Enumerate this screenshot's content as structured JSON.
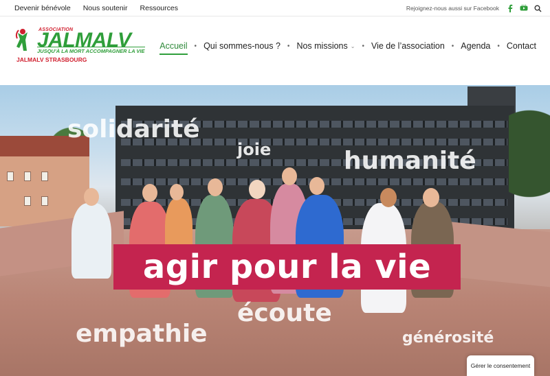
{
  "topbar": {
    "links": [
      "Devenir bénévole",
      "Nous soutenir",
      "Ressources"
    ],
    "facebook_text": "Rejoignez-nous aussi sur Facebook",
    "icons": [
      "facebook-icon",
      "youtube-icon",
      "search-icon"
    ]
  },
  "logo": {
    "assoc": "ASSOCIATION",
    "brand": "JALMALV",
    "tagline": "JUSQU'À LA MORT ACCOMPAGNER LA VIE",
    "city": "JALMALV STRASBOURG"
  },
  "nav": {
    "items": [
      {
        "label": "Accueil",
        "active": true
      },
      {
        "label": "Qui sommes-nous ?"
      },
      {
        "label": "Nos missions",
        "has_dropdown": true
      },
      {
        "label": "Vie de l’association"
      },
      {
        "label": "Agenda"
      },
      {
        "label": "Contact"
      }
    ]
  },
  "hero": {
    "words": {
      "solidarite": "solidarité",
      "joie": "joie",
      "humanite": "humanité",
      "ecoute": "écoute",
      "empathie": "empathie",
      "generosite": "générosité"
    },
    "banner": "agir pour la vie"
  },
  "consent": {
    "label": "Gérer le consentement"
  },
  "colors": {
    "green": "#2f9e3a",
    "red": "#d01f2e",
    "banner": "#c4244f"
  }
}
